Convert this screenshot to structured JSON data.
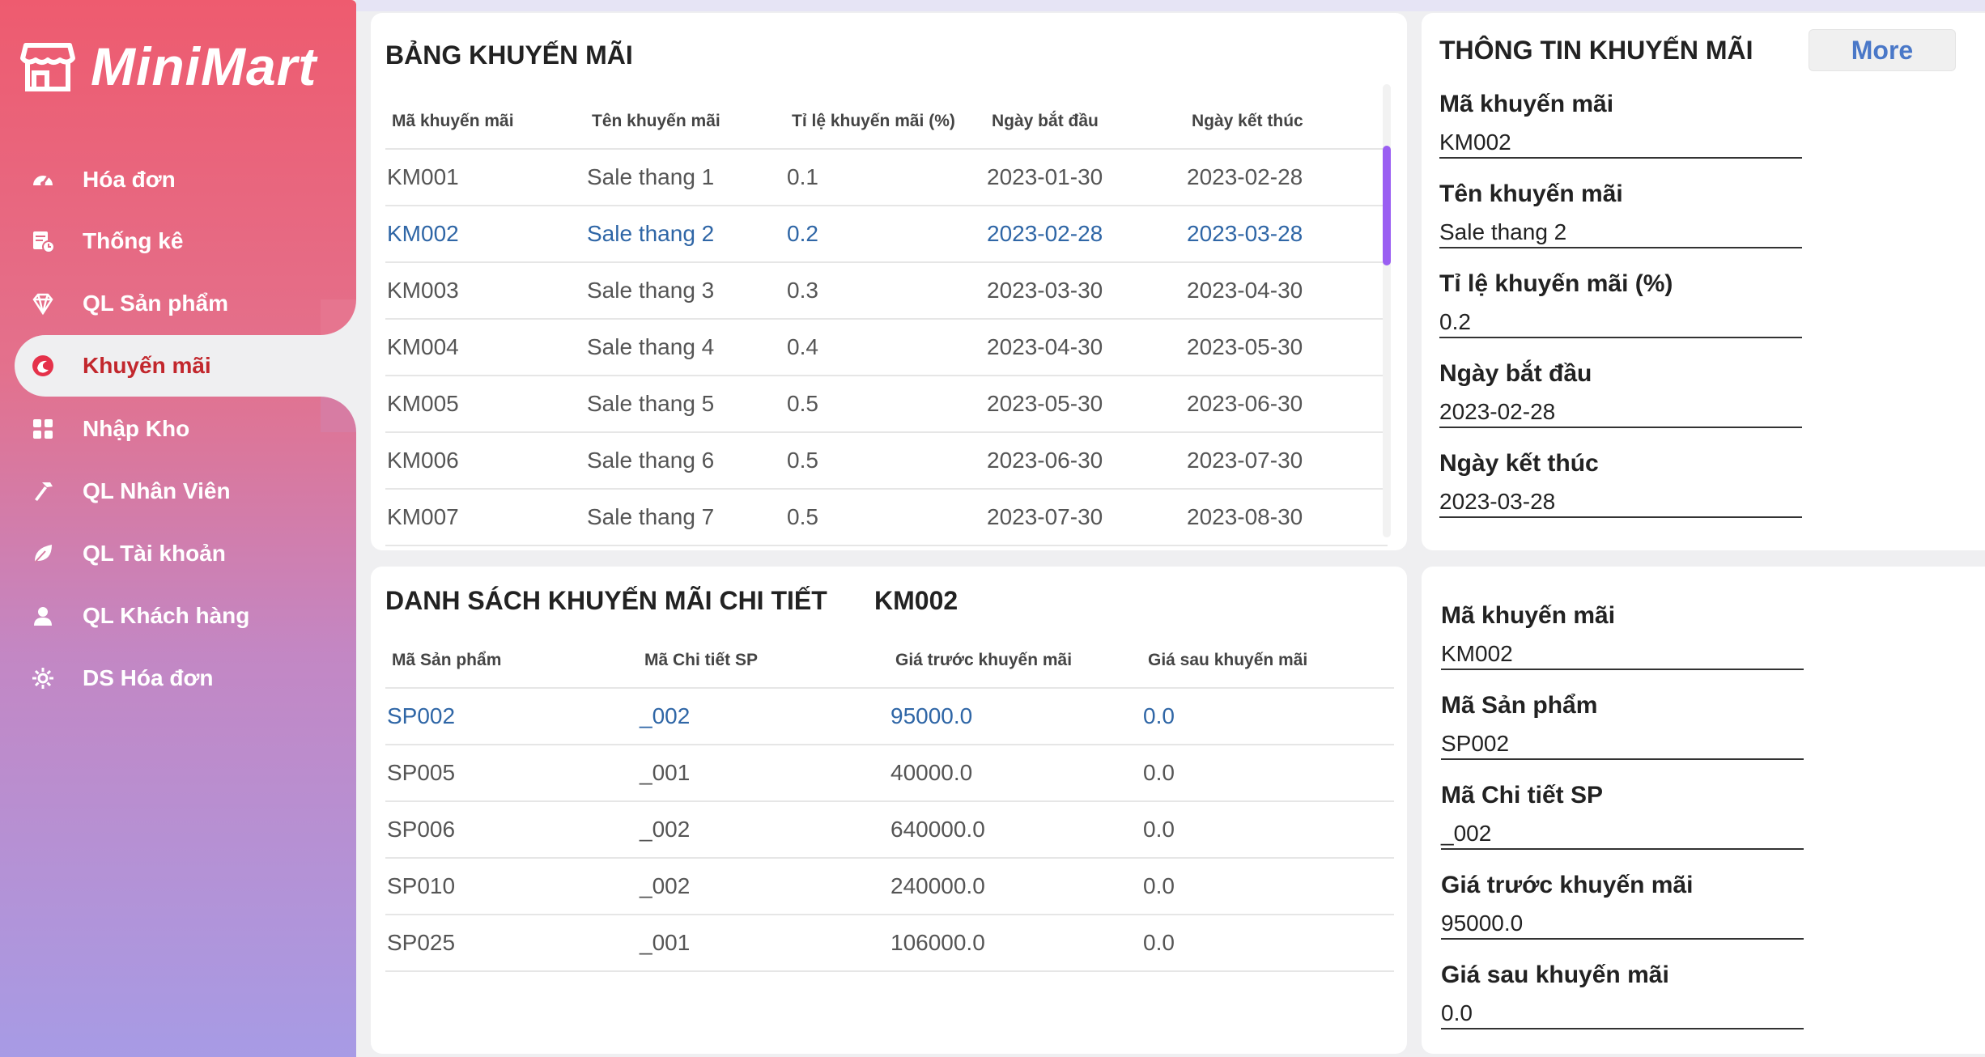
{
  "app": {
    "name": "MiniMart"
  },
  "sidebar": {
    "items": [
      {
        "label": "Hóa đơn",
        "icon": "dashboard-gauge-icon"
      },
      {
        "label": "Thống kê",
        "icon": "report-clock-icon"
      },
      {
        "label": "QL Sản phẩm",
        "icon": "diamond-icon"
      },
      {
        "label": "Khuyến mãi",
        "icon": "promotion-swirl-icon",
        "active": true
      },
      {
        "label": "Nhập Kho",
        "icon": "grid-icon"
      },
      {
        "label": "QL Nhân Viên",
        "icon": "hammer-icon"
      },
      {
        "label": "QL Tài khoản",
        "icon": "leaf-icon"
      },
      {
        "label": "QL Khách hàng",
        "icon": "user-icon"
      },
      {
        "label": "DS Hóa đơn",
        "icon": "gear-icon"
      }
    ]
  },
  "promo_table": {
    "title": "BẢNG KHUYẾN MÃI",
    "columns": [
      "Mã khuyến mãi",
      "Tên khuyến mãi",
      "Tỉ lệ khuyến mãi (%)",
      "Ngày bắt đầu",
      "Ngày kết thúc"
    ],
    "rows": [
      [
        "KM001",
        "Sale thang 1",
        "0.1",
        "2023-01-30",
        "2023-02-28"
      ],
      [
        "KM002",
        "Sale thang 2",
        "0.2",
        "2023-02-28",
        "2023-03-28"
      ],
      [
        "KM003",
        "Sale thang 3",
        "0.3",
        "2023-03-30",
        "2023-04-30"
      ],
      [
        "KM004",
        "Sale thang 4",
        "0.4",
        "2023-04-30",
        "2023-05-30"
      ],
      [
        "KM005",
        "Sale thang 5",
        "0.5",
        "2023-05-30",
        "2023-06-30"
      ],
      [
        "KM006",
        "Sale thang 6",
        "0.5",
        "2023-06-30",
        "2023-07-30"
      ],
      [
        "KM007",
        "Sale thang 7",
        "0.5",
        "2023-07-30",
        "2023-08-30"
      ]
    ],
    "selected_index": 1
  },
  "promo_info": {
    "title": "THÔNG TIN KHUYẾN MÃI",
    "more_label": "More",
    "fields": [
      {
        "label": "Mã khuyến mãi",
        "value": "KM002"
      },
      {
        "label": "Tên khuyến mãi",
        "value": "Sale thang 2"
      },
      {
        "label": "Tỉ lệ khuyến mãi (%)",
        "value": "0.2"
      },
      {
        "label": "Ngày bắt đầu",
        "value": "2023-02-28"
      },
      {
        "label": "Ngày kết thúc",
        "value": "2023-03-28"
      }
    ]
  },
  "detail_table": {
    "title": "DANH SÁCH KHUYẾN MÃI CHI TIẾT",
    "promo_code": "KM002",
    "columns": [
      "Mã Sản phẩm",
      "Mã Chi tiết SP",
      "Giá trước khuyến mãi",
      "Giá sau khuyến mãi"
    ],
    "rows": [
      [
        "SP002",
        "_002",
        "95000.0",
        "0.0"
      ],
      [
        "SP005",
        "_001",
        "40000.0",
        "0.0"
      ],
      [
        "SP006",
        "_002",
        "640000.0",
        "0.0"
      ],
      [
        "SP010",
        "_002",
        "240000.0",
        "0.0"
      ],
      [
        "SP025",
        "_001",
        "106000.0",
        "0.0"
      ]
    ],
    "selected_index": 0
  },
  "detail_info": {
    "fields": [
      {
        "label": "Mã khuyến mãi",
        "value": "KM002"
      },
      {
        "label": "Mã Sản phẩm",
        "value": "SP002"
      },
      {
        "label": "Mã Chi tiết SP",
        "value": "_002"
      },
      {
        "label": "Giá trước khuyến mãi",
        "value": "95000.0"
      },
      {
        "label": "Giá sau khuyến mãi",
        "value": "0.0"
      }
    ]
  },
  "colors": {
    "accent_active": "#c2272d",
    "selected_row": "#2f66a6",
    "scroll_thumb": "#9a5ef2",
    "more_text": "#4a78c8"
  }
}
